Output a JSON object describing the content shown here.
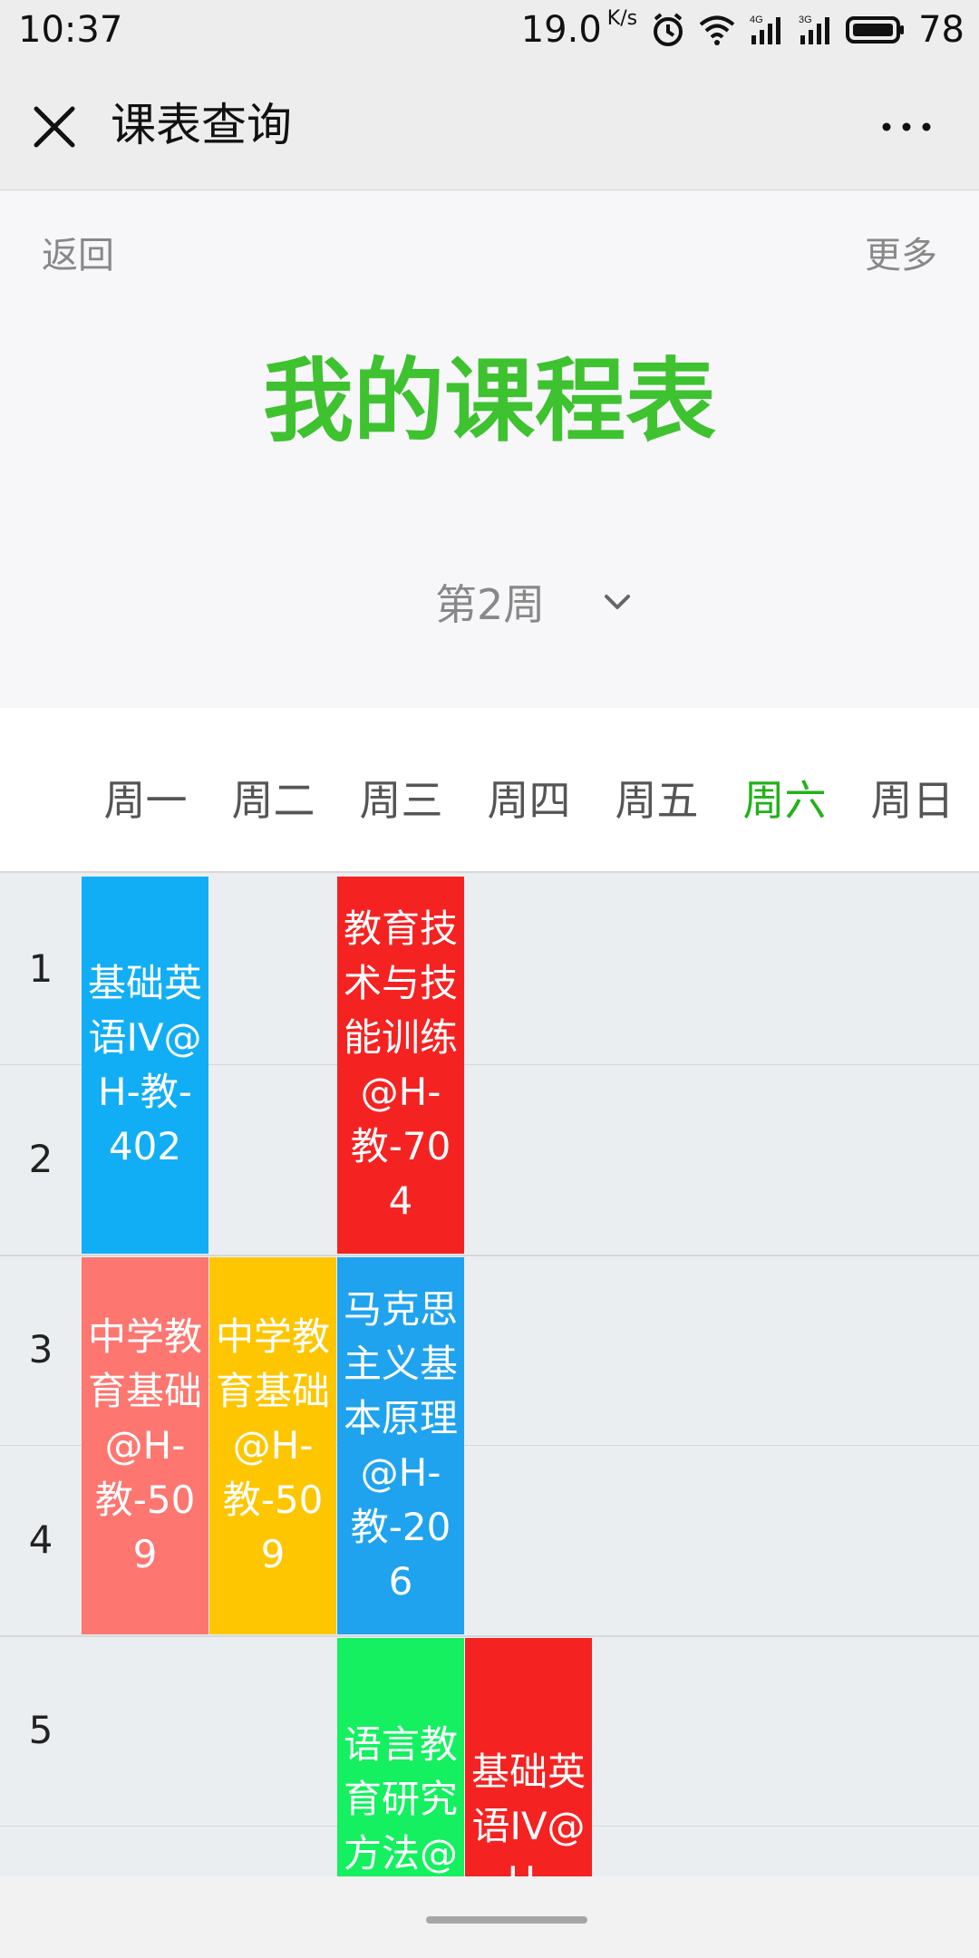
{
  "status_bar": {
    "time": "10:37",
    "speed": "19.0",
    "speed_unit": "K/s",
    "battery": "78",
    "net1": "4G",
    "net2": "3G"
  },
  "nav": {
    "title": "课表查询"
  },
  "header": {
    "back_label": "返回",
    "more_label": "更多",
    "title": "我的课程表",
    "week_label": "第2周"
  },
  "days": [
    "周一",
    "周二",
    "周三",
    "周四",
    "周五",
    "周六",
    "周日"
  ],
  "active_day_index": 5,
  "periods": [
    "1",
    "2",
    "3",
    "4",
    "5"
  ],
  "courses": [
    {
      "text": "基础英语IV@H-教-402",
      "day": 0,
      "start": 1,
      "span": 2,
      "color": "#12aef5"
    },
    {
      "text": "教育技术与技能训练@H-教-704",
      "day": 2,
      "start": 1,
      "span": 2,
      "color": "#f52222"
    },
    {
      "text": "中学教育基础@H-教-509",
      "day": 0,
      "start": 3,
      "span": 2,
      "color": "#fd7670"
    },
    {
      "text": "中学教育基础@H-教-509",
      "day": 1,
      "start": 3,
      "span": 2,
      "color": "#fdc600"
    },
    {
      "text": "马克思主义基本原理@H-教-206",
      "day": 2,
      "start": 3,
      "span": 2,
      "color": "#20a3ee"
    },
    {
      "text": "语言教育研究方法@H-",
      "day": 2,
      "start": 5,
      "span": 2,
      "color": "#14f060"
    },
    {
      "text": "基础英语IV@H-",
      "day": 3,
      "start": 5,
      "span": 2,
      "color": "#f52222"
    }
  ],
  "colors": {
    "title_green": "#3ec22f",
    "active_day": "#22b11a"
  }
}
